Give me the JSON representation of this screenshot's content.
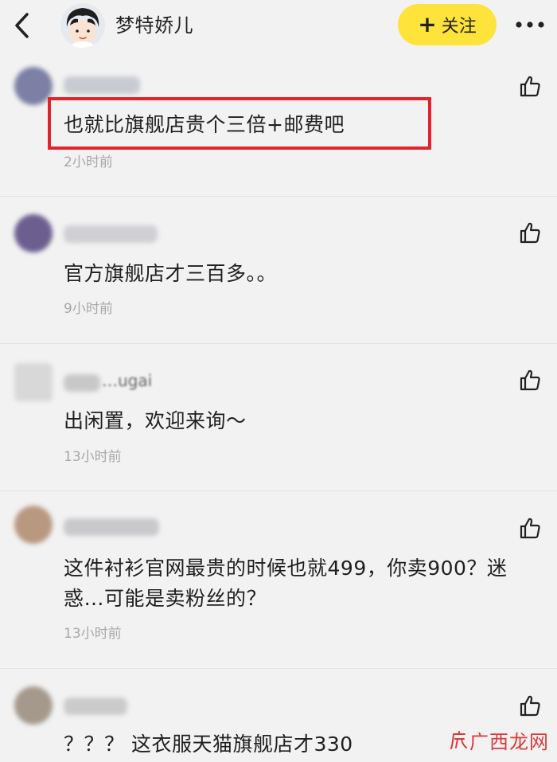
{
  "header": {
    "back_icon": "chevron-left-icon",
    "user_name": "梦特娇儿",
    "follow_label": "关注",
    "follow_plus": "+",
    "follow_color": "#fde33a",
    "more_icon": "more-horizontal-icon"
  },
  "comments": [
    {
      "text": "也就比旗舰店贵个三倍+邮费吧",
      "time": "2小时前"
    },
    {
      "text": "官方旗舰店才三百多。。",
      "time": "9小时前"
    },
    {
      "text": "出闲置，欢迎来询～",
      "time": "13小时前",
      "user_partial": "…ugai"
    },
    {
      "text": "这件衬衫官网最贵的时候也就499，你卖900？迷惑…可能是卖粉丝的？",
      "time": "13小时前"
    },
    {
      "text": "？？？ 这衣服天猫旗舰店才330",
      "time": ""
    }
  ],
  "highlight_color": "#e0242c",
  "watermark": {
    "text": "广西龙网",
    "color": "#d83a3a"
  }
}
